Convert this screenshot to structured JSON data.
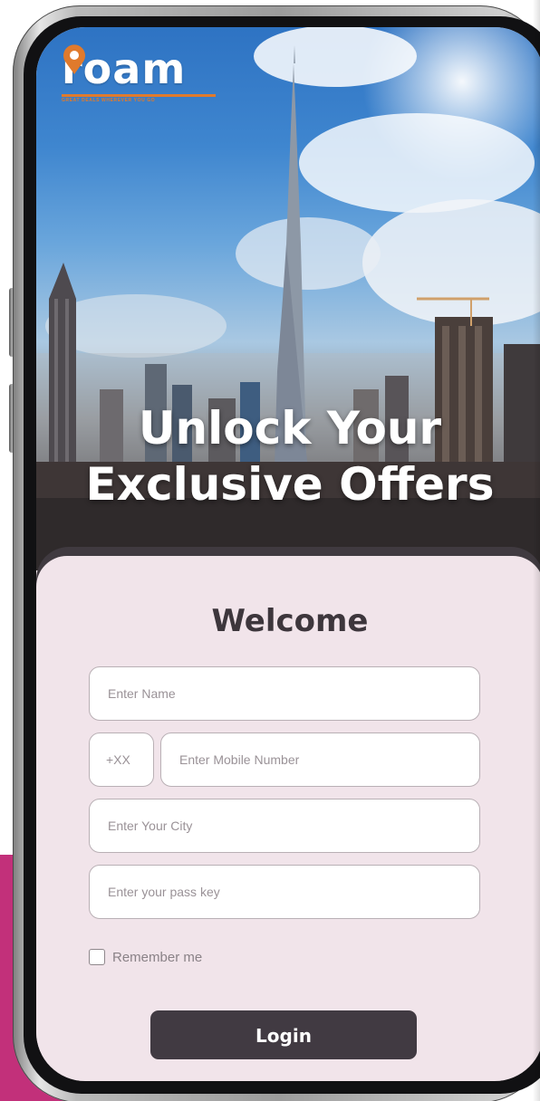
{
  "brand": {
    "logo_text": "roam",
    "tagline": "GREAT DEALS WHEREVER YOU GO",
    "accent_color": "#e07a2c"
  },
  "hero": {
    "headline_line1": "Unlock Your",
    "headline_line2": "Exclusive Offers"
  },
  "form": {
    "title": "Welcome",
    "name_placeholder": "Enter Name",
    "country_code_placeholder": "+XX",
    "mobile_placeholder": "Enter Mobile Number",
    "city_placeholder": "Enter Your City",
    "passkey_placeholder": "Enter your pass key",
    "remember_label": "Remember me",
    "remember_checked": false,
    "login_label": "Login"
  },
  "colors": {
    "card_background": "#f1e4ea",
    "button_background": "#413a42",
    "side_block": "#c2307a"
  }
}
